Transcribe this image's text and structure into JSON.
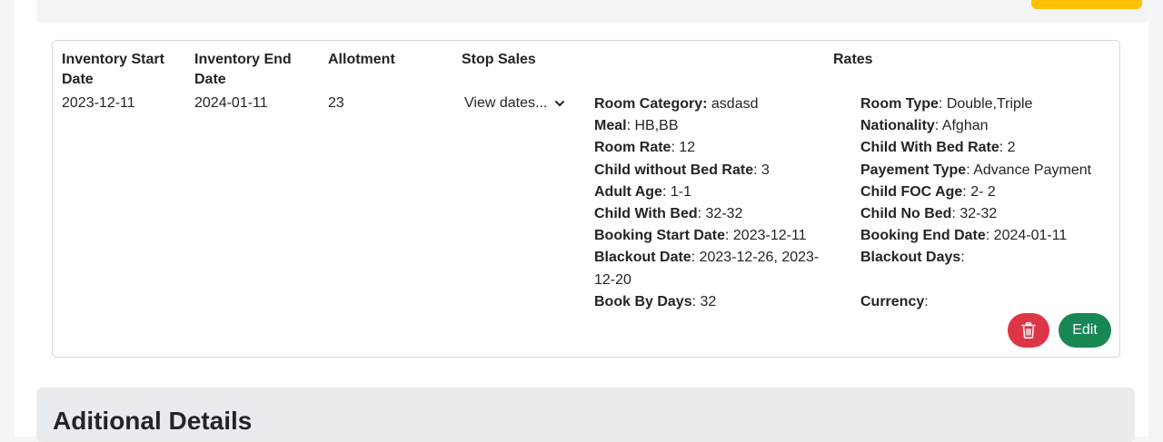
{
  "table": {
    "headers": {
      "inventory_start_line1": "Inventory Start",
      "inventory_start_line2": "Date",
      "inventory_end_line1": "Inventory End",
      "inventory_end_line2": "Date",
      "allotment": "Allotment",
      "stop_sales": "Stop Sales",
      "rates": "Rates"
    },
    "row": {
      "inventory_start": "2023-12-11",
      "inventory_end": "2024-01-11",
      "allotment": "23",
      "stop_sales_label": "View dates..."
    }
  },
  "rates_left": [
    {
      "label": "Room Category:",
      "value": " asdasd"
    },
    {
      "label": "Meal",
      "value": ": HB,BB"
    },
    {
      "label": "Room Rate",
      "value": ": 12"
    },
    {
      "label": "Child without Bed Rate",
      "value": ": 3"
    },
    {
      "label": "Adult Age",
      "value": ": 1-1"
    },
    {
      "label": "Child With Bed",
      "value": ": 32-32"
    },
    {
      "label": "Booking Start Date",
      "value": ": 2023-12-11"
    },
    {
      "label": "Blackout Date",
      "value": ": 2023-12-26, 2023-"
    },
    {
      "label": "",
      "value": "12-20"
    },
    {
      "label": "Book By Days",
      "value": ": 32"
    }
  ],
  "rates_right": [
    {
      "label": "Room Type",
      "value": ": Double,Triple"
    },
    {
      "label": "Nationality",
      "value": ": Afghan"
    },
    {
      "label": "Child With Bed Rate",
      "value": ": 2"
    },
    {
      "label": "Payement Type",
      "value": ": Advance Payment"
    },
    {
      "label": "Child FOC Age",
      "value": ": 2- 2"
    },
    {
      "label": "Child No Bed",
      "value": ": 32-32"
    },
    {
      "label": "Booking End Date",
      "value": ": 2024-01-11"
    },
    {
      "label": "Blackout Days",
      "value": ":"
    },
    {
      "label": "",
      "value": ""
    },
    {
      "label": "Currency",
      "value": ":"
    }
  ],
  "actions": {
    "edit_label": "Edit",
    "delete_icon": "trash-icon"
  },
  "additional": {
    "title": "Aditional Details"
  },
  "colors": {
    "delete": "#dc3545",
    "edit": "#198754",
    "accent_yellow": "#ffc107"
  }
}
